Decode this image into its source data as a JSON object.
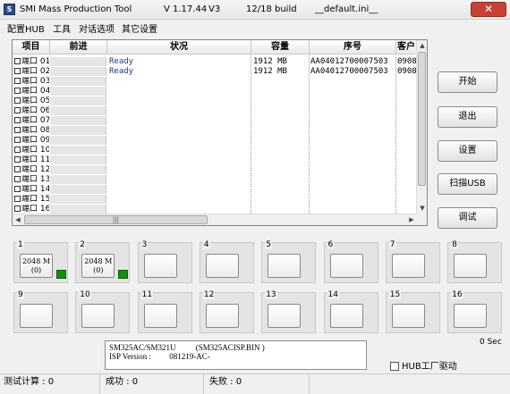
{
  "window": {
    "title": "SMI Mass Production Tool",
    "version": "V 1.17.44",
    "v3": "V3",
    "build": "12/18 build",
    "ini": "__default.ini__",
    "close_glyph": "✕"
  },
  "menu": [
    "配置HUB",
    "工具",
    "对话选项",
    "其它设置"
  ],
  "table": {
    "headers": [
      "项目",
      "前进",
      "状况",
      "容量",
      "序号",
      "客户"
    ],
    "rows": [
      {
        "port": "端口 01",
        "status": "Ready",
        "capacity": "1912 MB",
        "serial": "AA04012700007503",
        "extra": "0908"
      },
      {
        "port": "端口 02",
        "status": "Ready",
        "capacity": "1912 MB",
        "serial": "AA04012700007503",
        "extra": "0908"
      },
      {
        "port": "端口 03",
        "status": "",
        "capacity": "",
        "serial": "",
        "extra": ""
      },
      {
        "port": "端口 04",
        "status": "",
        "capacity": "",
        "serial": "",
        "extra": ""
      },
      {
        "port": "端口 05",
        "status": "",
        "capacity": "",
        "serial": "",
        "extra": ""
      },
      {
        "port": "端口 06",
        "status": "",
        "capacity": "",
        "serial": "",
        "extra": ""
      },
      {
        "port": "端口 07",
        "status": "",
        "capacity": "",
        "serial": "",
        "extra": ""
      },
      {
        "port": "端口 08",
        "status": "",
        "capacity": "",
        "serial": "",
        "extra": ""
      },
      {
        "port": "端口 09",
        "status": "",
        "capacity": "",
        "serial": "",
        "extra": ""
      },
      {
        "port": "端口 10",
        "status": "",
        "capacity": "",
        "serial": "",
        "extra": ""
      },
      {
        "port": "端口 11",
        "status": "",
        "capacity": "",
        "serial": "",
        "extra": ""
      },
      {
        "port": "端口 12",
        "status": "",
        "capacity": "",
        "serial": "",
        "extra": ""
      },
      {
        "port": "端口 13",
        "status": "",
        "capacity": "",
        "serial": "",
        "extra": ""
      },
      {
        "port": "端口 14",
        "status": "",
        "capacity": "",
        "serial": "",
        "extra": ""
      },
      {
        "port": "端口 15",
        "status": "",
        "capacity": "",
        "serial": "",
        "extra": ""
      },
      {
        "port": "端口 16",
        "status": "",
        "capacity": "",
        "serial": "",
        "extra": ""
      }
    ]
  },
  "buttons": {
    "start": "开始",
    "exit": "退出",
    "settings": "设置",
    "scan_usb": "扫描USB",
    "debug": "调试"
  },
  "ports": [
    {
      "num": "1",
      "line1": "2048 M",
      "line2": "(0)",
      "active": true
    },
    {
      "num": "2",
      "line1": "2048 M",
      "line2": "(0)",
      "active": true
    },
    {
      "num": "3",
      "line1": "",
      "line2": "",
      "active": false
    },
    {
      "num": "4",
      "line1": "",
      "line2": "",
      "active": false
    },
    {
      "num": "5",
      "line1": "",
      "line2": "",
      "active": false
    },
    {
      "num": "6",
      "line1": "",
      "line2": "",
      "active": false
    },
    {
      "num": "7",
      "line1": "",
      "line2": "",
      "active": false
    },
    {
      "num": "8",
      "line1": "",
      "line2": "",
      "active": false
    },
    {
      "num": "9",
      "line1": "",
      "line2": "",
      "active": false
    },
    {
      "num": "10",
      "line1": "",
      "line2": "",
      "active": false
    },
    {
      "num": "11",
      "line1": "",
      "line2": "",
      "active": false
    },
    {
      "num": "12",
      "line1": "",
      "line2": "",
      "active": false
    },
    {
      "num": "13",
      "line1": "",
      "line2": "",
      "active": false
    },
    {
      "num": "14",
      "line1": "",
      "line2": "",
      "active": false
    },
    {
      "num": "15",
      "line1": "",
      "line2": "",
      "active": false
    },
    {
      "num": "16",
      "line1": "",
      "line2": "",
      "active": false
    }
  ],
  "info": {
    "controller": "SM325AC/SM321U",
    "isp_file": "(SM325ACISP.BIN )",
    "isp_label": "ISP Version :",
    "isp_version": "081219-AC-"
  },
  "elapsed": "0 Sec",
  "hub_factory_driver": "HUB工厂驱动",
  "status": {
    "test_count": "测试计算 : 0",
    "success": "成功 : 0",
    "fail": "失败 : 0"
  },
  "colors": {
    "led_active": "#109010",
    "ready_text": "#1a3a8a"
  }
}
